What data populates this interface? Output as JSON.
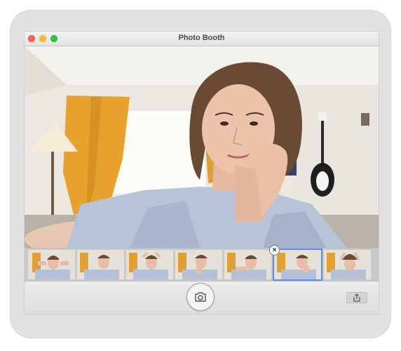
{
  "window": {
    "title": "Photo Booth"
  },
  "icons": {
    "shutter": "camera-icon",
    "share": "share-icon",
    "remove": "close-icon"
  },
  "filmstrip": {
    "remove_badge": "×",
    "thumbnail_count": 7,
    "selected_index": 5
  },
  "colors": {
    "close": "#fe5f57",
    "minimize": "#febc2e",
    "maximize": "#28c840",
    "selection": "#5b8ee6"
  }
}
